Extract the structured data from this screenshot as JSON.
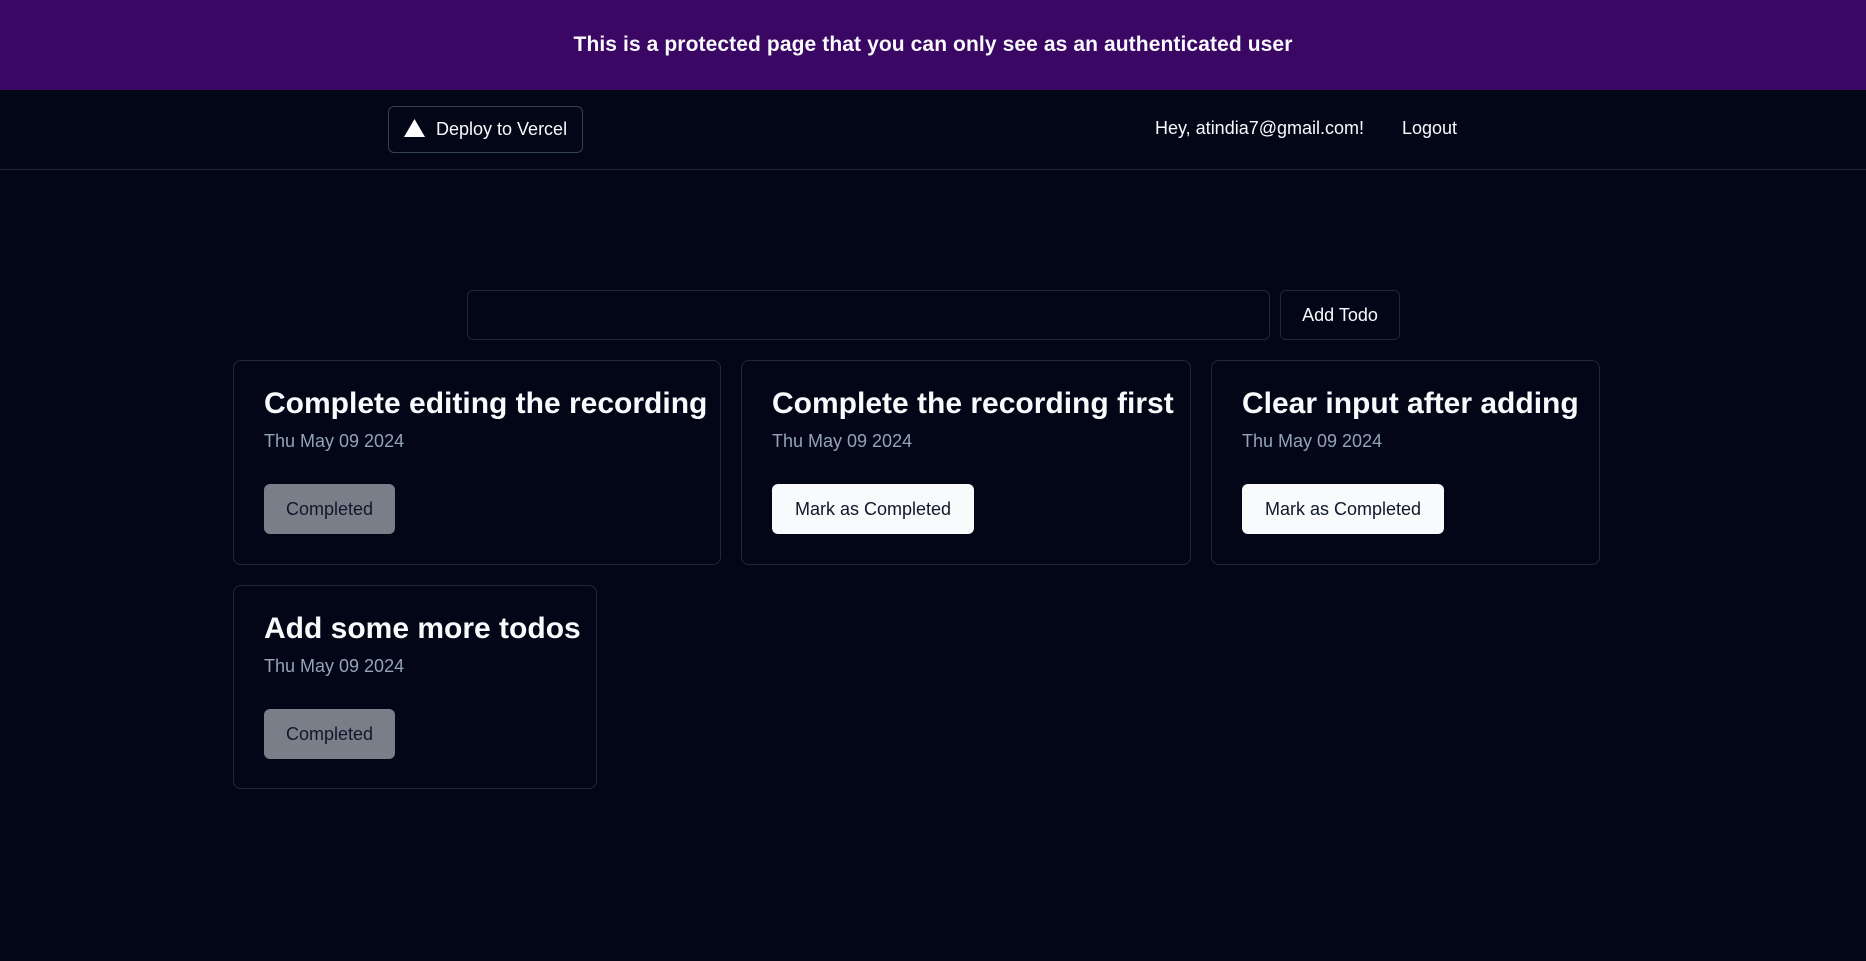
{
  "banner": {
    "text": "This is a protected page that you can only see as an authenticated user"
  },
  "navbar": {
    "deploy_label": "Deploy to Vercel",
    "deploy_icon": "vercel-triangle-icon",
    "greeting": "Hey, atindia7@gmail.com!",
    "logout_label": "Logout"
  },
  "todo_form": {
    "input_value": "",
    "input_placeholder": "",
    "add_label": "Add Todo"
  },
  "todos": [
    {
      "title": "Complete editing the recording",
      "date": "Thu May 09 2024",
      "button_label": "Completed",
      "completed": true
    },
    {
      "title": "Complete the recording first",
      "date": "Thu May 09 2024",
      "button_label": "Mark as Completed",
      "completed": false
    },
    {
      "title": "Clear input after adding",
      "date": "Thu May 09 2024",
      "button_label": "Mark as Completed",
      "completed": false
    },
    {
      "title": "Add some more todos",
      "date": "Thu May 09 2024",
      "button_label": "Completed",
      "completed": true
    }
  ],
  "colors": {
    "background": "#020617",
    "banner": "#3b0764",
    "border": "#1e293b",
    "muted_text": "#94a3b8",
    "completed_button": "#797e89",
    "primary_button": "#f8fafc"
  }
}
